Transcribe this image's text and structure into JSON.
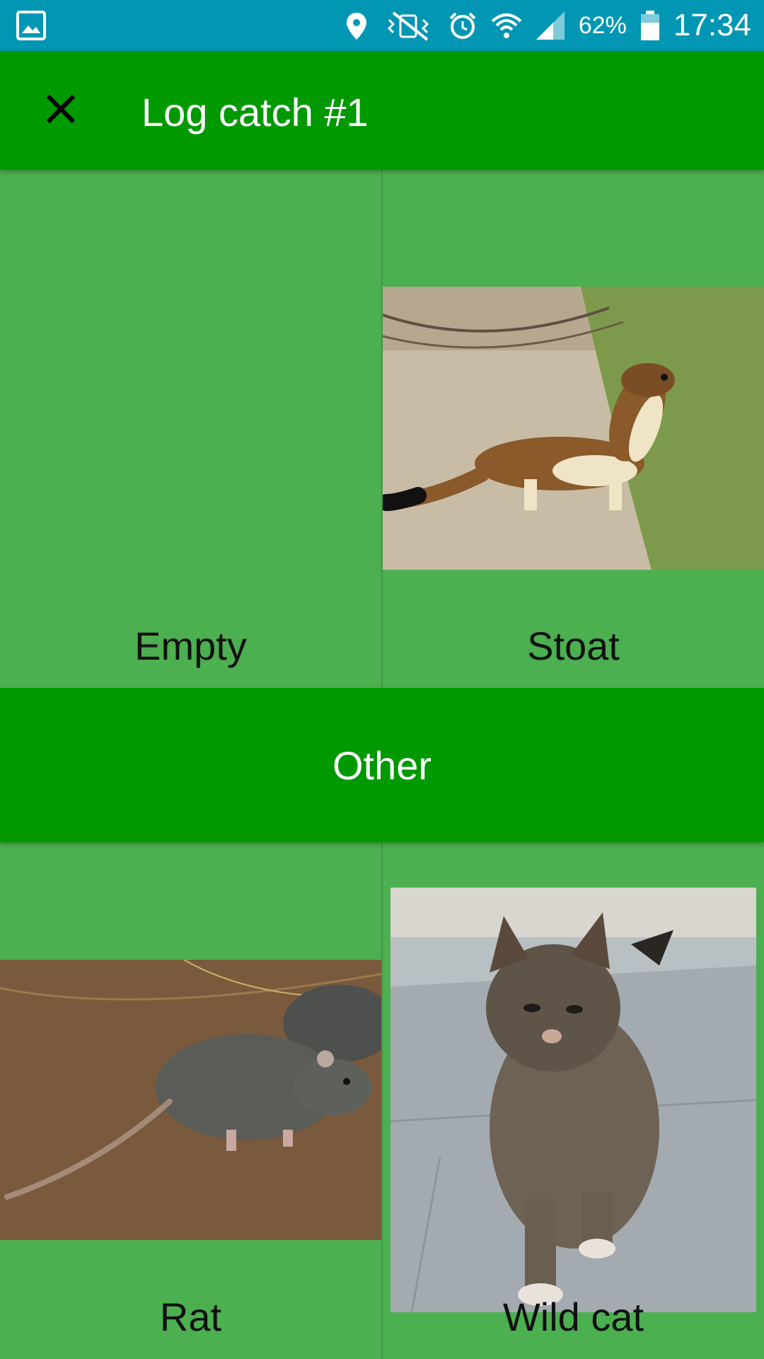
{
  "status_bar": {
    "battery": "62%",
    "time": "17:34",
    "icons": [
      "gallery-icon",
      "location-icon",
      "vibrate-icon",
      "alarm-icon",
      "wifi-icon",
      "signal-icon",
      "battery-icon"
    ]
  },
  "app_bar": {
    "title": "Log catch #1",
    "close_icon": "close-icon"
  },
  "tiles": [
    {
      "label": "Empty",
      "image": "none"
    },
    {
      "label": "Stoat",
      "image": "stoat-photo"
    },
    {
      "label": "Rat",
      "image": "rat-photo"
    },
    {
      "label": "Wild cat",
      "image": "wild-cat-photo"
    }
  ],
  "other_button": {
    "label": "Other"
  },
  "colors": {
    "status_bar": "#0096b4",
    "app_bar": "#009900",
    "tile_background": "#4CAF50",
    "other_button": "#009900"
  }
}
